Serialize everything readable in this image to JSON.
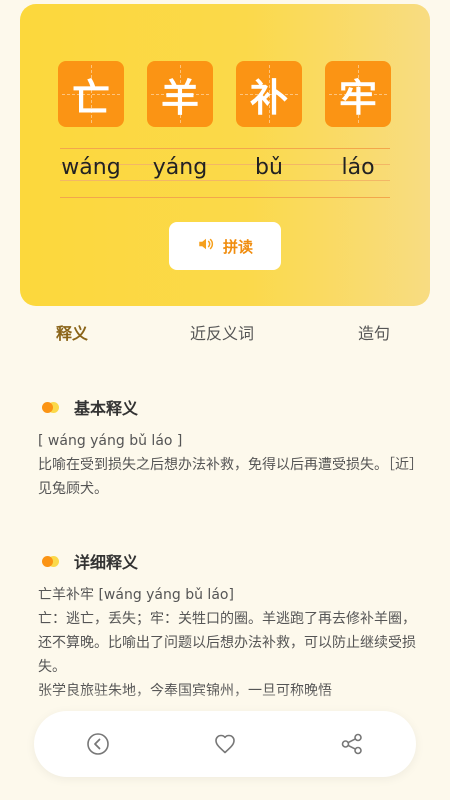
{
  "hero": {
    "characters": [
      "亡",
      "羊",
      "补",
      "牢"
    ],
    "pinyin": [
      "wáng",
      "yáng",
      "bǔ",
      "láo"
    ],
    "speak_button_label": "拼读",
    "speak_icon": "speaker-icon"
  },
  "tabs": [
    "释义",
    "近反义词",
    "造句"
  ],
  "active_tab": "释义",
  "sections": {
    "basic": {
      "title": "基本释义",
      "lines": [
        "[ wáng yáng bǔ láo ]",
        "比喻在受到损失之后想办法补救，免得以后再遭受损失。［近］见兔顾犬。"
      ]
    },
    "detail": {
      "title": "详细释义",
      "lines": [
        "亡羊补牢 [wáng yáng bǔ láo]",
        " 亡：逃亡，丢失；牢：关牲口的圈。羊逃跑了再去修补羊圈，还不算晚。比喻出了问题以后想办法补救，可以防止继续受损失。",
        "张学良旅驻朱地，今奉国宾锦州，一旦可称晚悟"
      ]
    }
  },
  "bottom_bar": {
    "icons": [
      "back-icon",
      "heart-icon",
      "share-icon"
    ]
  },
  "colors": {
    "accent_orange": "#fb9414",
    "accent_yellow": "#fcd83c",
    "background": "#fdf9ec"
  }
}
